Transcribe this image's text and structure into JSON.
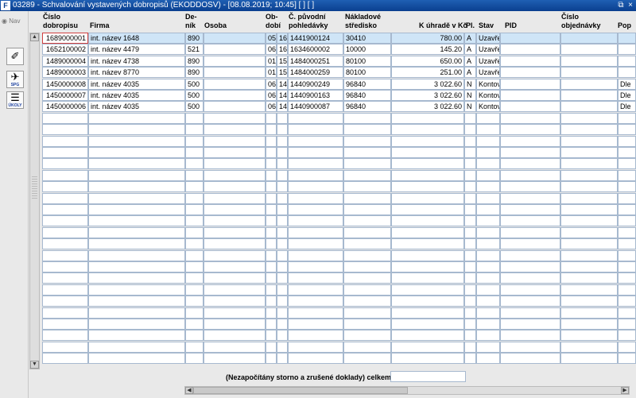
{
  "window": {
    "icon": "F",
    "title": "03289 - Schvalování vystavených dobropisů (EKODDOSV) - [08.08.2019; 10:45]  [ ]  [ ]",
    "restore_icon": "restore-icon",
    "close_icon": "close-icon",
    "restore_glyph": "⧉",
    "close_glyph": "×"
  },
  "sidebar": {
    "nav_label": "Nav",
    "tools": [
      {
        "icon": "erase-icon",
        "glyph": "✐",
        "label": ""
      },
      {
        "icon": "spg-icon",
        "glyph": "✈",
        "label": "SPG"
      },
      {
        "icon": "tasks-icon",
        "glyph": "☰",
        "label": "ÚKOLY"
      }
    ]
  },
  "table": {
    "headers": {
      "cislo_dobropisu": [
        "Číslo",
        "dobropisu"
      ],
      "firma": "Firma",
      "denik": [
        "De-",
        "ník"
      ],
      "osoba": "Osoba",
      "obdobi": [
        "Ob-",
        "dobí"
      ],
      "puvodni_pohledavka": [
        "Č. původní",
        "pohledávky"
      ],
      "nakladove_stredisko": [
        "Nákladové",
        "středisko"
      ],
      "k_uhrade": "K úhradě v Kč",
      "pl": "Pl.",
      "stav": "Stav",
      "pid": "PID",
      "cislo_objednavky": [
        "Číslo",
        "objednávky"
      ],
      "popis": "Pop"
    },
    "rows": [
      {
        "cislo": "1689000001",
        "firma": "int. název 1648",
        "denik": "890",
        "osoba": "",
        "ob1": "05",
        "ob2": "16",
        "pohledavka": "1441900124",
        "stredisko": "30410",
        "castka": "780.00",
        "pl": "A",
        "stav": "Uzavře",
        "pid": "",
        "objednavka": "",
        "popis": ""
      },
      {
        "cislo": "1652100002",
        "firma": "int. název 4479",
        "denik": "521",
        "osoba": "",
        "ob1": "06",
        "ob2": "16",
        "pohledavka": "1634600002",
        "stredisko": "10000",
        "castka": "145.20",
        "pl": "A",
        "stav": "Uzavře",
        "pid": "",
        "objednavka": "",
        "popis": ""
      },
      {
        "cislo": "1489000004",
        "firma": "int. název 4738",
        "denik": "890",
        "osoba": "",
        "ob1": "01",
        "ob2": "15",
        "pohledavka": "1484000251",
        "stredisko": "80100",
        "castka": "650.00",
        "pl": "A",
        "stav": "Uzavře",
        "pid": "",
        "objednavka": "",
        "popis": ""
      },
      {
        "cislo": "1489000003",
        "firma": "int. název 8770",
        "denik": "890",
        "osoba": "",
        "ob1": "01",
        "ob2": "15",
        "pohledavka": "1484000259",
        "stredisko": "80100",
        "castka": "251.00",
        "pl": "A",
        "stav": "Uzavře",
        "pid": "",
        "objednavka": "",
        "popis": ""
      },
      {
        "cislo": "1450000008",
        "firma": "int. název 4035",
        "denik": "500",
        "osoba": "",
        "ob1": "06",
        "ob2": "14",
        "pohledavka": "1440900249",
        "stredisko": "96840",
        "castka": "3 022.60",
        "pl": "N",
        "stav": "Kontov",
        "pid": "",
        "objednavka": "",
        "popis": "Dle"
      },
      {
        "cislo": "1450000007",
        "firma": "int. název 4035",
        "denik": "500",
        "osoba": "",
        "ob1": "06",
        "ob2": "14",
        "pohledavka": "1440900163",
        "stredisko": "96840",
        "castka": "3 022.60",
        "pl": "N",
        "stav": "Kontov",
        "pid": "",
        "objednavka": "",
        "popis": "Dle"
      },
      {
        "cislo": "1450000006",
        "firma": "int. název 4035",
        "denik": "500",
        "osoba": "",
        "ob1": "06",
        "ob2": "14",
        "pohledavka": "1440900087",
        "stredisko": "96840",
        "castka": "3 022.60",
        "pl": "N",
        "stav": "Kontov",
        "pid": "",
        "objednavka": "",
        "popis": "Dle"
      }
    ]
  },
  "footer": {
    "total_label": "(Nezapočítány storno a zrušené doklady) celkem",
    "total_value": ""
  },
  "scrollbars": {
    "up_glyph": "▲",
    "down_glyph": "▼",
    "left_glyph": "◀",
    "right_glyph": "▶"
  }
}
